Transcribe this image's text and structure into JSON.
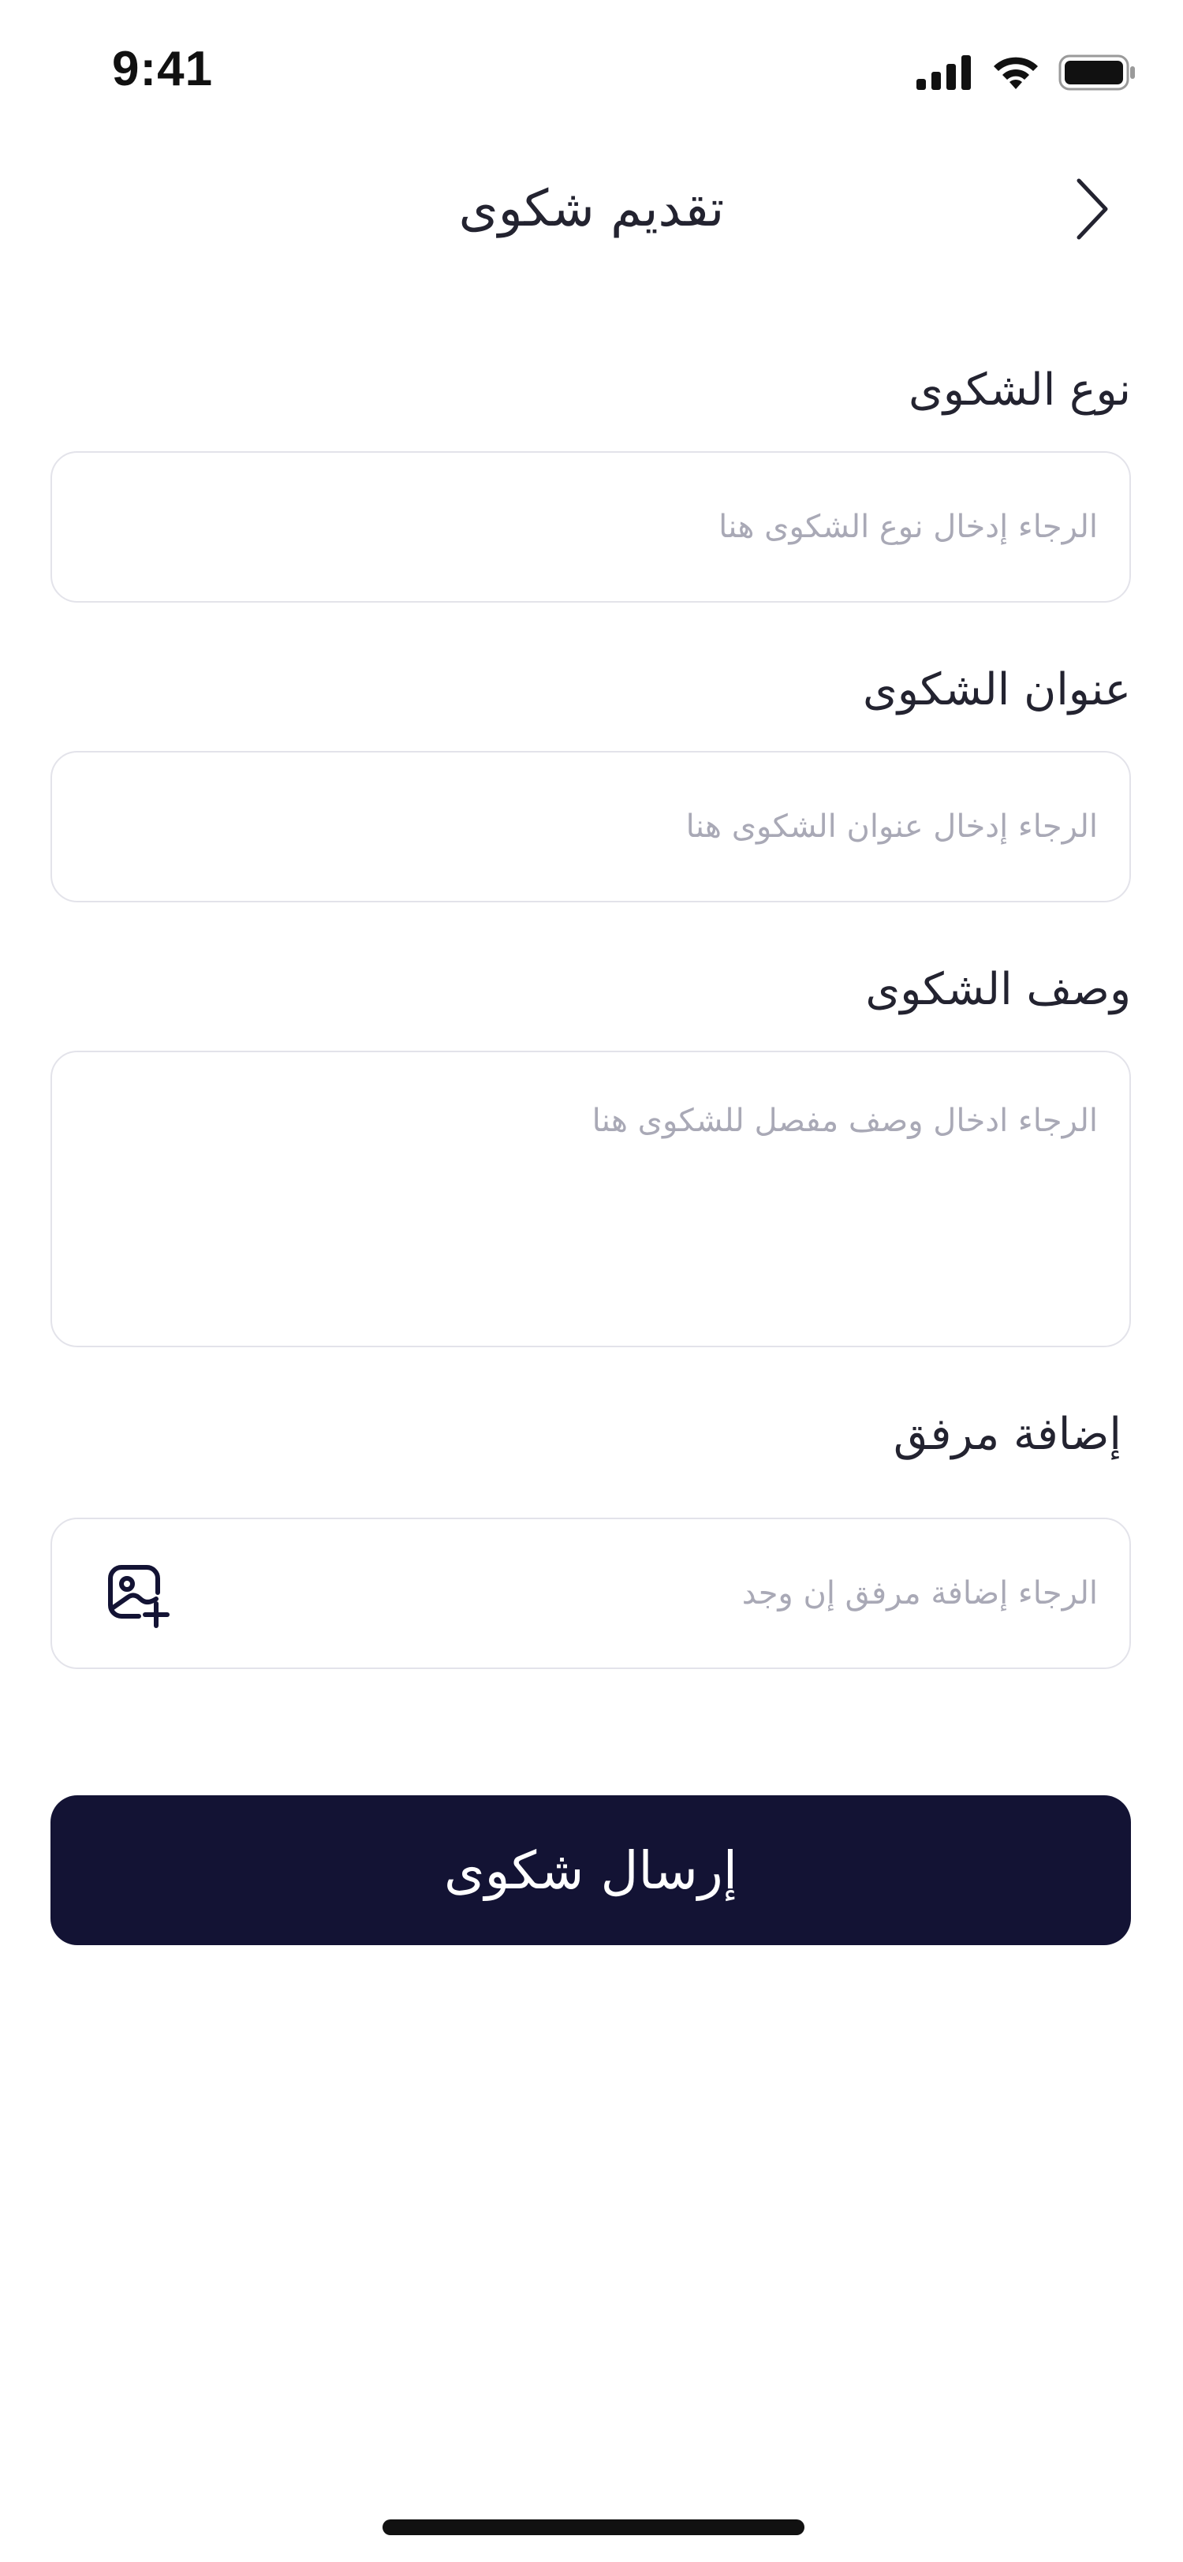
{
  "status_bar": {
    "time": "9:41",
    "icons": [
      "signal-icon",
      "wifi-icon",
      "battery-icon"
    ]
  },
  "header": {
    "title": "تقديم شكوى",
    "back_icon": "chevron-right-icon"
  },
  "form": {
    "complaint_type": {
      "label": "نوع الشكوى",
      "placeholder": "الرجاء إدخال نوع الشكوى هنا",
      "value": ""
    },
    "complaint_title": {
      "label": "عنوان الشكوى",
      "placeholder": "الرجاء إدخال عنوان الشكوى هنا",
      "value": ""
    },
    "complaint_description": {
      "label": "وصف الشكوى",
      "placeholder": "الرجاء ادخال وصف مفصل للشكوى هنا",
      "value": ""
    },
    "attachment": {
      "label": "إضافة مرفق",
      "placeholder": "الرجاء إضافة مرفق إن وجد",
      "icon": "image-add-icon"
    }
  },
  "submit": {
    "label": "إرسال شكوى"
  },
  "colors": {
    "primary": "#131334",
    "border": "#e3e3ea",
    "placeholder": "#a9a9b6",
    "text": "#232330"
  }
}
